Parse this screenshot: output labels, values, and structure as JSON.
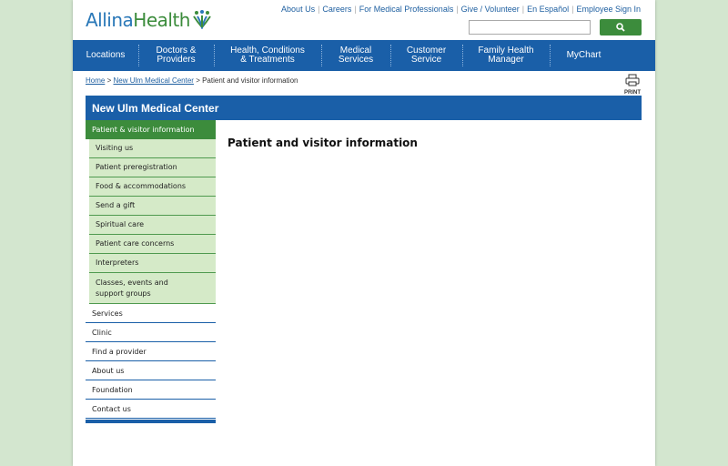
{
  "brand": {
    "part1": "Allina",
    "part2": "Health"
  },
  "utility_links": [
    "About Us",
    "Careers",
    "For Medical Professionals",
    "Give / Volunteer",
    "En Español",
    "Employee Sign In"
  ],
  "search": {
    "placeholder": "",
    "button_icon": "search-icon"
  },
  "nav": [
    {
      "line1": "Locations",
      "line2": ""
    },
    {
      "line1": "Doctors &",
      "line2": "Providers"
    },
    {
      "line1": "Health, Conditions",
      "line2": "& Treatments"
    },
    {
      "line1": "Medical",
      "line2": "Services"
    },
    {
      "line1": "Customer",
      "line2": "Service"
    },
    {
      "line1": "Family Health",
      "line2": "Manager"
    },
    {
      "line1": "MyChart",
      "line2": ""
    }
  ],
  "breadcrumb": {
    "home": "Home",
    "sep": ">",
    "parent": "New Ulm Medical Center",
    "current": "Patient and visitor information"
  },
  "print_label": "PRINT",
  "section_title": "New Ulm Medical Center",
  "sidebar": {
    "active": "Patient & visitor information",
    "sub_items": [
      "Visiting us",
      "Patient preregistration",
      "Food & accommodations",
      "Send a gift",
      "Spiritual care",
      "Patient care concerns",
      "Interpreters"
    ],
    "sub_item_tall": {
      "line1": "Classes, events and",
      "line2": "support groups"
    },
    "items": [
      "Services",
      "Clinic",
      "Find a provider",
      "About us",
      "Foundation",
      "Contact us"
    ]
  },
  "page_title": "Patient and visitor information",
  "colors": {
    "brand_blue": "#1a5fa8",
    "brand_green": "#3c8c3c",
    "sub_bg": "#d5eac8",
    "page_bg": "#d3e6cf"
  }
}
